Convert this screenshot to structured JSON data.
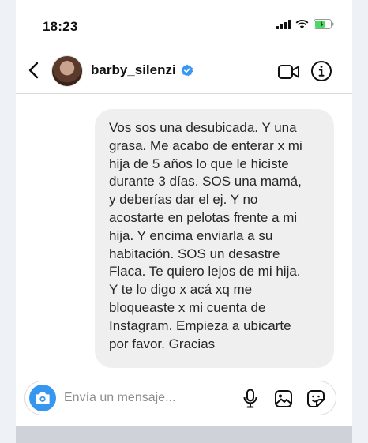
{
  "status_bar": {
    "time": "18:23"
  },
  "header": {
    "username": "barby_silenzi"
  },
  "message": {
    "text": "Vos sos una  desubicada.  Y una\ngrasa.  Me acabo de enterar x mi\nhija de 5 años lo que le hiciste\ndurante 3 días.  SOS una mamá,\ny deberías dar el ej. Y no\nacostarte en pelotas frente a mi\nhija.  Y encima enviarla a su\nhabitación.  SOS un desastre\nFlaca. Te quiero lejos de mi hija.\nY te lo digo x acá xq me\nbloqueaste x mi cuenta de\nInstagram.  Empieza a ubicarte\npor favor.  Gracias"
  },
  "composer": {
    "placeholder": "Envía un mensaje..."
  },
  "colors": {
    "bubble": "#efefef",
    "accent": "#3797f0",
    "verified": "#3897f0"
  },
  "icons": [
    "signal-icon",
    "wifi-icon",
    "battery-icon",
    "back-arrow-icon",
    "verified-badge-icon",
    "video-call-icon",
    "info-icon",
    "camera-icon",
    "microphone-icon",
    "gallery-icon",
    "sticker-icon"
  ]
}
